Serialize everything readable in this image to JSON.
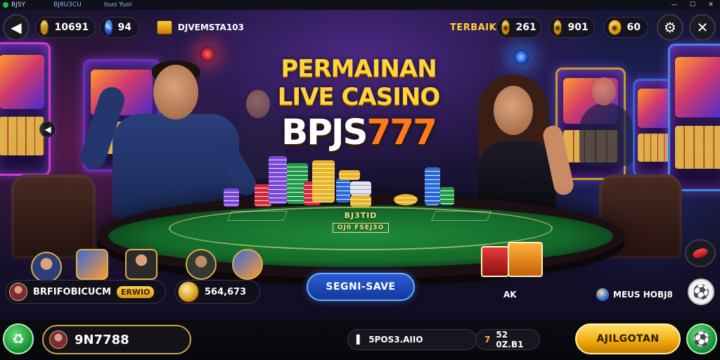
{
  "window": {
    "app_name": "BJSY",
    "tab1": "BJ8U3CU",
    "tab2": "Isuo Yuoi",
    "minimize": "—",
    "maximize": "☐",
    "close": "✕"
  },
  "hud": {
    "back_icon": "arrow-left-icon",
    "balance": "10691",
    "gems": "94",
    "event_label": "DJVEMSTA103",
    "terbaik_label": "TERBAIK",
    "stat1": "261",
    "stat2": "901",
    "stat3": "60"
  },
  "hero": {
    "line1": "PERMAINAN",
    "line2": "LIVE CASINO",
    "brand_part1": "BPJS",
    "brand_part2": "777"
  },
  "table": {
    "logo": "BJ3TID",
    "logo_sub": "OJ0 FSEJ3O"
  },
  "players": {
    "left_name": "BRFIFOBICUCM",
    "left_tag": "ERWIO",
    "left_amount": "564,673",
    "center_button": "SEGNI-SAVE",
    "gift_label": "AK",
    "right_label": "MEUS HOBJ8"
  },
  "bottom": {
    "user_id": "9N7788",
    "info1": "5POS3.AIIO",
    "info2_prefix": "7",
    "info2": "52 0Z.B1",
    "action_button": "AJILGOTAN"
  },
  "colors": {
    "accent_gold": "#ffd33a",
    "brand_orange": "#ff7a1a",
    "table_green": "#1f8a3a",
    "button_blue": "#2a5ad8"
  }
}
